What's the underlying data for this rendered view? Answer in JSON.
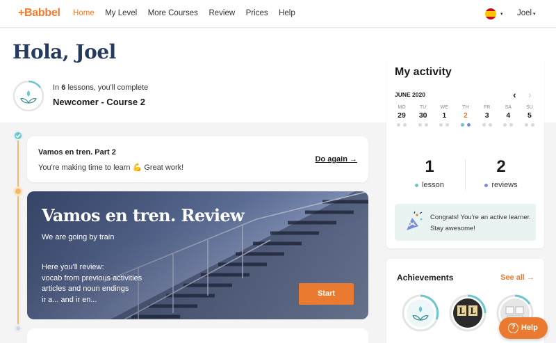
{
  "nav": {
    "logo": "+Babbel",
    "links": [
      "Home",
      "My Level",
      "More Courses",
      "Review",
      "Prices",
      "Help"
    ],
    "active_index": 0,
    "user": "Joel",
    "caret": "▾"
  },
  "hero": {
    "greeting": "Hola, Joel",
    "intro_prefix": "In",
    "intro_count": "6",
    "intro_suffix": "lessons, you'll complete",
    "course_name": "Newcomer - Course 2"
  },
  "lessons": [
    {
      "title": "Vamos en tren. Part 2",
      "message": "You're making time to learn 💪 Great work!",
      "action": "Do again →"
    },
    {
      "title": "Vamos en tren. Review",
      "subtitle": "We are going by train",
      "review_lines": [
        "Here you'll review:",
        "vocab from previous activities",
        "articles and noun endings",
        "ir a... and ir en..."
      ],
      "action": "Start"
    }
  ],
  "activity": {
    "title": "My activity",
    "month": "JUNE 2020",
    "prev_arrow": "‹",
    "next_arrow": "›",
    "days": [
      {
        "name": "MO",
        "date": "29"
      },
      {
        "name": "TU",
        "date": "30"
      },
      {
        "name": "WE",
        "date": "1"
      },
      {
        "name": "TH",
        "date": "2"
      },
      {
        "name": "FR",
        "date": "3"
      },
      {
        "name": "SA",
        "date": "4"
      },
      {
        "name": "SU",
        "date": "5"
      }
    ],
    "today_index": 3,
    "lessons_count": "1",
    "lessons_label": "lesson",
    "reviews_count": "2",
    "reviews_label": "reviews",
    "congrats": "Congrats! You're an active learner. Stay awesome!",
    "colors": {
      "lesson": "#6dc6cf",
      "review": "#7a8bd6",
      "accent": "#e97a2f"
    }
  },
  "achievements": {
    "title": "Achievements",
    "see_all": "See all →"
  },
  "help": {
    "label": "Help",
    "icon": "?"
  }
}
